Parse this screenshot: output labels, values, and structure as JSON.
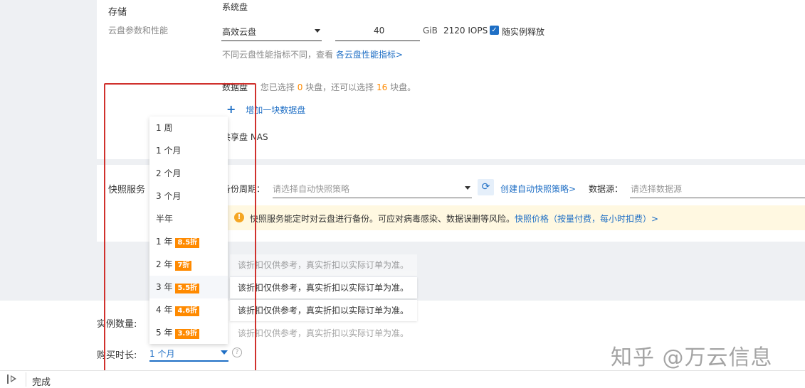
{
  "storage": {
    "section_label": "存储",
    "sub_label": "云盘参数和性能",
    "system_disk_label": "系统盘",
    "disk_type": "高效云盘",
    "disk_size": "40",
    "unit": "GiB",
    "iops": "2120 IOPS",
    "release_label": "随实例释放",
    "perf_note": "不同云盘性能指标不同，查看",
    "perf_link": "各云盘性能指标>",
    "data_disk_label": "数据盘",
    "data_disk_note_a": "您已选择",
    "data_disk_selected": "0",
    "data_disk_note_b": "块盘，还可以选择",
    "data_disk_remaining": "16",
    "data_disk_note_c": "块盘。",
    "add_disk_label": "增加一块数据盘",
    "nas_label": "共享盘 NAS"
  },
  "snapshot": {
    "label": "快照服务",
    "backup_cycle_label": "备份周期：",
    "policy_placeholder": "请选择自动快照策略",
    "create_link": "创建自动快照策略>",
    "datasource_label": "数据源：",
    "datasource_placeholder": "请选择数据源",
    "notice_text": "快照服务能定时对云盘进行备份。可应对病毒感染、数据误删等风险。",
    "notice_link": "快照价格（按量付费，每小时扣费）>"
  },
  "bottom": {
    "instance_count_label": "实例数量:",
    "duration_label": "购买时长:",
    "duration_value": "1 个月",
    "help_glyph": "?"
  },
  "dropdown": {
    "options": [
      {
        "label": "1 周",
        "badge": ""
      },
      {
        "label": "1 个月",
        "badge": ""
      },
      {
        "label": "2 个月",
        "badge": ""
      },
      {
        "label": "3 个月",
        "badge": ""
      },
      {
        "label": "半年",
        "badge": ""
      },
      {
        "label": "1 年",
        "badge": "8.5折"
      },
      {
        "label": "2 年",
        "badge": "7折"
      },
      {
        "label": "3 年",
        "badge": "5.5折"
      },
      {
        "label": "4 年",
        "badge": "4.6折"
      },
      {
        "label": "5 年",
        "badge": "3.9折"
      }
    ]
  },
  "tips": [
    "该折扣仅供参考，真实折扣以实际订单为准。",
    "该折扣仅供参考，真实折扣以实际订单为准。",
    "该折扣仅供参考，真实折扣以实际订单为准。",
    "该折扣仅供参考，真实折扣以实际订单为准。"
  ],
  "status_bar": {
    "text": "完成"
  },
  "watermark": "知乎 @万云信息",
  "colors": {
    "accent": "#1f6fc5",
    "discount": "#ff8a00",
    "highlight_frame": "#d0312d",
    "notice_bg": "#fff8e1"
  }
}
